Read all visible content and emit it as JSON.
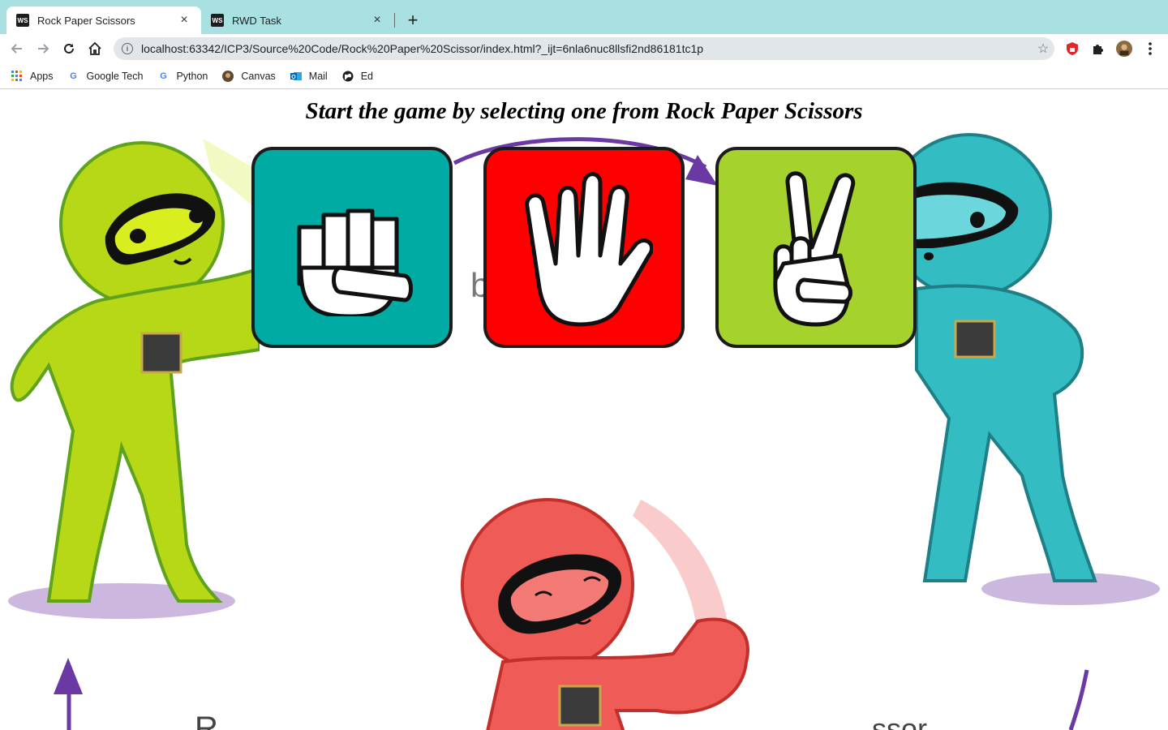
{
  "browser": {
    "tabs": [
      {
        "title": "Rock Paper Scissors",
        "favicon": "WS",
        "active": true
      },
      {
        "title": "RWD Task",
        "favicon": "WS",
        "active": false
      }
    ],
    "close_glyph": "×",
    "new_tab_glyph": "+",
    "url": "localhost:63342/ICP3/Source%20Code/Rock%20Paper%20Scissor/index.html?_ijt=6nla6nuc8llsfi2nd86181tc1p",
    "bookmarks": [
      {
        "label": "Apps",
        "icon": "apps-grid-icon"
      },
      {
        "label": "Google Tech",
        "icon": "google-icon"
      },
      {
        "label": "Python",
        "icon": "google-icon"
      },
      {
        "label": "Canvas",
        "icon": "canvas-icon"
      },
      {
        "label": "Mail",
        "icon": "outlook-icon"
      },
      {
        "label": "Ed",
        "icon": "globe-icon"
      }
    ]
  },
  "page": {
    "headline": "Start the game by selecting one from Rock Paper Scissors",
    "choices": [
      {
        "name": "Rock",
        "icon": "fist-icon",
        "color": "#00aba4"
      },
      {
        "name": "Paper",
        "icon": "open-hand-icon",
        "color": "#ff0000"
      },
      {
        "name": "Scissors",
        "icon": "peace-hand-icon",
        "color": "#a5d22c"
      }
    ]
  }
}
